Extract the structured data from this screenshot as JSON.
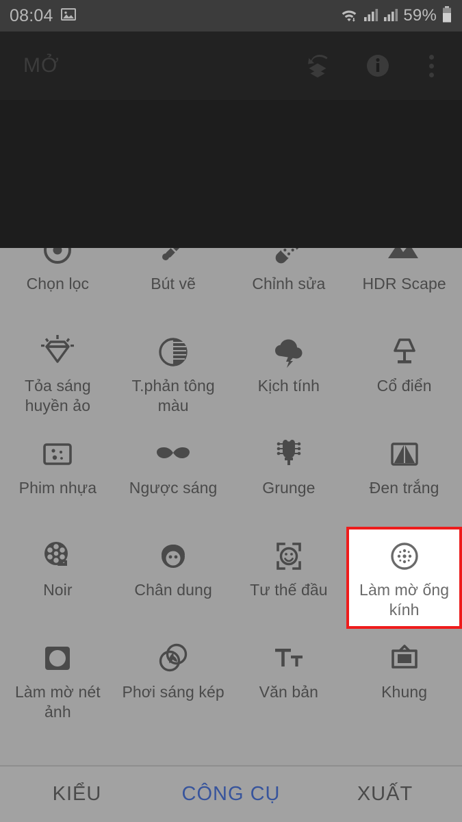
{
  "status_bar": {
    "clock": "08:04",
    "gallery_icon": "image-icon",
    "wifi_icon": "wifi-icon",
    "signal_icon_1": "signal-bars-icon",
    "signal_icon_2": "signal-bars-icon",
    "battery_percent": "59%",
    "battery_icon": "battery-icon"
  },
  "toolbar": {
    "title": "MỞ",
    "undo_layers_icon": "undo-layers-icon",
    "info_icon": "info-icon",
    "overflow_icon": "more-vertical-icon"
  },
  "tools": [
    {
      "label": "Chọn lọc",
      "icon": "selective-target-icon"
    },
    {
      "label": "Bút vẽ",
      "icon": "brush-icon"
    },
    {
      "label": "Chỉnh sửa",
      "icon": "healing-bandage-icon"
    },
    {
      "label": "HDR Scape",
      "icon": "mountains-icon"
    },
    {
      "label": "Tỏa sáng huyền ảo",
      "icon": "diamond-glow-icon"
    },
    {
      "label": "T.phản tông màu",
      "icon": "tonal-contrast-icon"
    },
    {
      "label": "Kịch tính",
      "icon": "storm-cloud-icon"
    },
    {
      "label": "Cổ điển",
      "icon": "table-lamp-icon"
    },
    {
      "label": "Phim nhựa",
      "icon": "grainy-film-icon"
    },
    {
      "label": "Ngược sáng",
      "icon": "mustache-icon"
    },
    {
      "label": "Grunge",
      "icon": "guitar-headstock-icon"
    },
    {
      "label": "Đen trắng",
      "icon": "black-white-icon"
    },
    {
      "label": "Noir",
      "icon": "film-reel-icon"
    },
    {
      "label": "Chân dung",
      "icon": "portrait-face-icon"
    },
    {
      "label": "Tư thế đầu",
      "icon": "head-pose-icon"
    },
    {
      "label": "Làm mờ ống kính",
      "icon": "lens-blur-icon",
      "highlighted": true
    },
    {
      "label": "Làm mờ nét ảnh",
      "icon": "vignette-icon"
    },
    {
      "label": "Phơi sáng kép",
      "icon": "double-exposure-icon"
    },
    {
      "label": "Văn bản",
      "icon": "text-icon"
    },
    {
      "label": "Khung",
      "icon": "frame-icon"
    }
  ],
  "tabs": [
    {
      "label": "KIỂU",
      "active": false
    },
    {
      "label": "CÔNG CỤ",
      "active": true
    },
    {
      "label": "XUẤT",
      "active": false
    }
  ],
  "colors": {
    "highlight_border": "#ee1c1c",
    "active_tab": "#37549c",
    "panel_bg": "#a0a0a0",
    "toolbar_bg": "#222222",
    "status_bg": "#3c3c3c"
  }
}
